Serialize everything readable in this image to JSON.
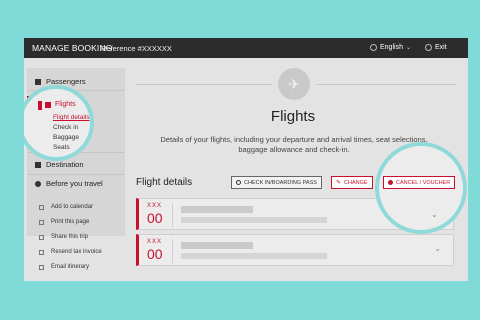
{
  "header": {
    "title": "MANAGE BOOKING",
    "reference": "Reference #XXXXXX",
    "language": "English",
    "exit": "Exit"
  },
  "sidebar": {
    "passengers": "Passengers",
    "flights": "Flights",
    "sub": [
      "Flight details",
      "Check in",
      "Baggage",
      "Seats"
    ],
    "destination": "Destination",
    "before_travel": "Before you travel"
  },
  "links": [
    "Add to calendar",
    "Print this page",
    "Share this trip",
    "Resend tax invoice",
    "Email itinerary"
  ],
  "main": {
    "heading": "Flights",
    "description": "Details of your flights, including your departure and arrival times, seat selections, baggage allowance and check-in.",
    "section_title": "Flight details",
    "buttons": {
      "checkin": "CHECK IN/BOARDING PASS",
      "change": "CHANGE",
      "cancel": "CANCEL / VOUCHER"
    },
    "cards": [
      {
        "code": "XXX",
        "num": "00"
      },
      {
        "code": "XXX",
        "num": "00"
      }
    ]
  },
  "colors": {
    "accent": "#c8102e",
    "background": "#7fdad8",
    "topbar": "#2c2c2c"
  }
}
